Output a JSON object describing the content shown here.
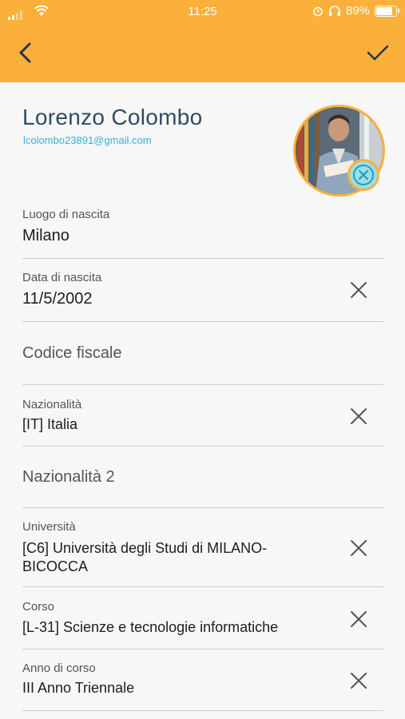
{
  "status": {
    "time": "11:25",
    "battery": "89%",
    "battery_level": 0.89
  },
  "header": {
    "back_icon": "chevron-left-icon",
    "save_icon": "check-icon",
    "background_color": "#fbb03b"
  },
  "profile": {
    "name": "Lorenzo Colombo",
    "email": "lcolombo23891@gmail.com"
  },
  "fields": {
    "birthplace": {
      "label": "Luogo di nascita",
      "value": "Milano"
    },
    "birthdate": {
      "label": "Data di nascita",
      "value": "11/5/2002"
    },
    "tax_code": {
      "placeholder": "Codice fiscale"
    },
    "nationality": {
      "label": "Nazionalità",
      "value": "[IT] Italia"
    },
    "nationality2": {
      "placeholder": "Nazionalità 2"
    },
    "university": {
      "label": "Università",
      "value_line1": "[C6] Università degli Studi di MILANO-",
      "value_line2": "BICOCCA"
    },
    "course": {
      "label": "Corso",
      "value": "[L-31] Scienze e tecnologie informatiche"
    },
    "year": {
      "label": "Anno di corso",
      "value": "III Anno Triennale"
    }
  },
  "colors": {
    "accent": "#fbb03b",
    "name": "#2f4b66",
    "email": "#39b0d6"
  }
}
